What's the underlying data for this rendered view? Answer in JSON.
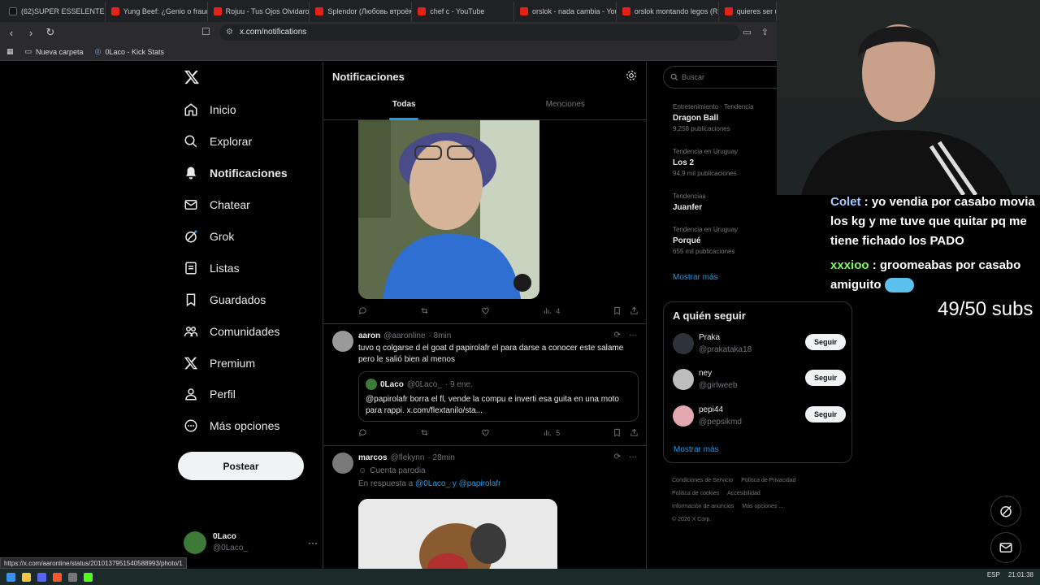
{
  "browser": {
    "tabs": [
      {
        "title": "(62)SUPER ESSELENTE #pe",
        "icon": "tiktok"
      },
      {
        "title": "Yung Beef: ¿Genio o fraud",
        "icon": "youtube"
      },
      {
        "title": "Rojuu - Tus Ojos Olvidaron",
        "icon": "youtube"
      },
      {
        "title": "Splendor (Любовь втроём",
        "icon": "youtube"
      },
      {
        "title": "chef c - YouTube",
        "icon": "youtube"
      },
      {
        "title": "orslok - nada cambia - You",
        "icon": "youtube"
      },
      {
        "title": "orslok montando legos (R",
        "icon": "youtube"
      },
      {
        "title": "quieres ser u",
        "icon": "youtube"
      }
    ],
    "url": "x.com/notifications",
    "bookmarks": [
      {
        "label": "Nueva carpeta",
        "icon": "folder-icon"
      },
      {
        "label": "0Laco - Kick Stats",
        "icon": "kick-icon"
      }
    ]
  },
  "sidebar": {
    "items": [
      {
        "label": "Inicio",
        "icon": "home-icon",
        "active": false
      },
      {
        "label": "Explorar",
        "icon": "search-icon",
        "active": false
      },
      {
        "label": "Notificaciones",
        "icon": "bell-icon",
        "active": true
      },
      {
        "label": "Chatear",
        "icon": "mail-icon",
        "active": false
      },
      {
        "label": "Grok",
        "icon": "grok-icon",
        "active": false
      },
      {
        "label": "Listas",
        "icon": "list-icon",
        "active": false
      },
      {
        "label": "Guardados",
        "icon": "bookmark-icon",
        "active": false
      },
      {
        "label": "Comunidades",
        "icon": "communities-icon",
        "active": false
      },
      {
        "label": "Premium",
        "icon": "x-icon",
        "active": false
      },
      {
        "label": "Perfil",
        "icon": "user-icon",
        "active": false
      },
      {
        "label": "Más opciones",
        "icon": "more-icon",
        "active": false
      }
    ],
    "post_label": "Postear",
    "account": {
      "name": "0Laco",
      "handle": "@0Laco_"
    }
  },
  "main": {
    "title": "Notificaciones",
    "tabs": [
      "Todas",
      "Menciones"
    ],
    "first_actions": {
      "views": "4"
    },
    "tweet1": {
      "name": "aaron",
      "handle": "@aaronline",
      "time": "· 8min",
      "text": "tuvo q colgarse d el goat d papirolafr el para darse a conocer este salame pero le salió bien al menos",
      "quote": {
        "name": "0Laco",
        "handle": "@0Laco_",
        "time": "· 9 ene.",
        "text": "@papirolafr borra el fl, vende la compu e inverti esa guita en una moto para rappi. x.com/flextanilo/sta..."
      },
      "views": "5"
    },
    "tweet2": {
      "name": "marcos",
      "handle": "@flekynn",
      "time": "· 28min",
      "parody": "Cuenta parodia",
      "reply_prefix": "En respuesta a",
      "reply_handles": "@0Laco_ y @papirolafr"
    }
  },
  "right": {
    "search_placeholder": "Buscar",
    "trends": [
      {
        "context": "Entretenimiento · Tendencia",
        "name": "Dragon Ball",
        "count": "9.258 publicaciones"
      },
      {
        "context": "Tendencia en Uruguay",
        "name": "Los 2",
        "count": "94,9 mil publicaciones"
      },
      {
        "context": "Tendencias",
        "name": "Juanfer",
        "count": ""
      },
      {
        "context": "Tendencia en Uruguay",
        "name": "Porqué",
        "count": "655 mil publicaciones"
      }
    ],
    "show_more": "Mostrar más",
    "follow_title": "A quién seguir",
    "follow": [
      {
        "name": "Praka",
        "handle": "@prakataka18",
        "button": "Seguir"
      },
      {
        "name": "ney",
        "handle": "@girlweeb",
        "button": "Seguir"
      },
      {
        "name": "pepi44",
        "handle": "@pepsikmd",
        "button": "Seguir"
      }
    ],
    "follow_more": "Mostrar más",
    "footer": [
      "Condiciones de Servicio",
      "Política de Privacidad",
      "Política de cookies",
      "Accesibilidad",
      "Información de anuncios",
      "Más opciones ...",
      "© 2026 X Corp."
    ]
  },
  "overlay": {
    "chat": [
      {
        "user": "Colet",
        "text": ": yo vendia por casabo movia los kg y me tuve que quitar pq me tiene fichado los PADO"
      },
      {
        "user": "xxxioo",
        "text": ": groomeabas por casabo amiguito"
      }
    ],
    "subs": "49/50 subs"
  },
  "status_url": "https://x.com/aaronline/status/2010137951540588993/photo/1",
  "taskbar": {
    "lang": "ESP",
    "time": "21:01:38"
  },
  "colors": {
    "accent": "#1d9bf0",
    "bg": "#000000",
    "text": "#e7e9ea",
    "muted": "#71767b"
  }
}
